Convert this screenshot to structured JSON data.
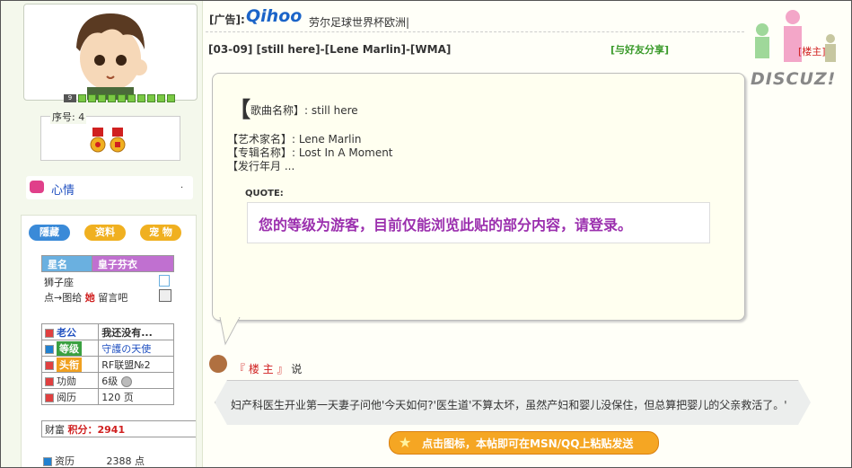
{
  "sidebar": {
    "level_badge": "9",
    "serial_label": "序号: 4",
    "mood_label": "心情",
    "mood_dot": ".",
    "tabs": [
      "隱藏",
      "资料",
      "宠 物"
    ],
    "star": {
      "label": "星名",
      "value": "皇子芬衣"
    },
    "zodiac": "狮子座",
    "message": {
      "prefix": "点→图给",
      "middle": "她",
      "suffix": "留言吧"
    },
    "partner": {
      "label": "老公",
      "value": "我还没有..."
    },
    "grade": {
      "label": "等级",
      "value": "守護の天使"
    },
    "title": {
      "label": "头衔",
      "value": "RF联盟№2"
    },
    "merit": {
      "label": "功勋",
      "value": "6级"
    },
    "reading": {
      "label": "阅历",
      "value": "120 页"
    },
    "wealth": {
      "label": "财富",
      "score_label": "积分：2941"
    },
    "capital": {
      "label": "资历",
      "value": "2388 点"
    }
  },
  "ad": {
    "label": "[广告]:",
    "brand": "Qihoo",
    "text": "劳尔足球世界杯欧洲|"
  },
  "post": {
    "title": "[03-09] [still here]-[Lene Marlin]-[WMA]",
    "share": "[与好友分享]",
    "floor": "[楼主]",
    "song_open": "【",
    "song_line": "歌曲名称】: still here",
    "artist": "【艺术家名】: Lene Marlin",
    "album": "【专辑名称】: Lost In A Moment",
    "release": "【发行年月 ...",
    "quote_label": "QUOTE:",
    "quote_text": "您的等级为游客，目前仅能浏览此贴的部分内容，请登录。"
  },
  "watermark": "DISCUZ!",
  "signature": {
    "label_open": "『 楼 主 』",
    "label_suffix": "说",
    "text": "妇产科医生开业第一天妻子问他'今天如何?'医生道'不算太坏，虽然产妇和婴儿没保住，但总算把婴儿的父亲救活了。'"
  },
  "msn_button": "点击图标，本帖即可在MSN/QQ上粘贴发送",
  "colors": {
    "accent_green": "#7ac943",
    "quote_purple": "#9b2fae",
    "brand_blue": "#1b64c8",
    "button_orange": "#f5a623"
  }
}
